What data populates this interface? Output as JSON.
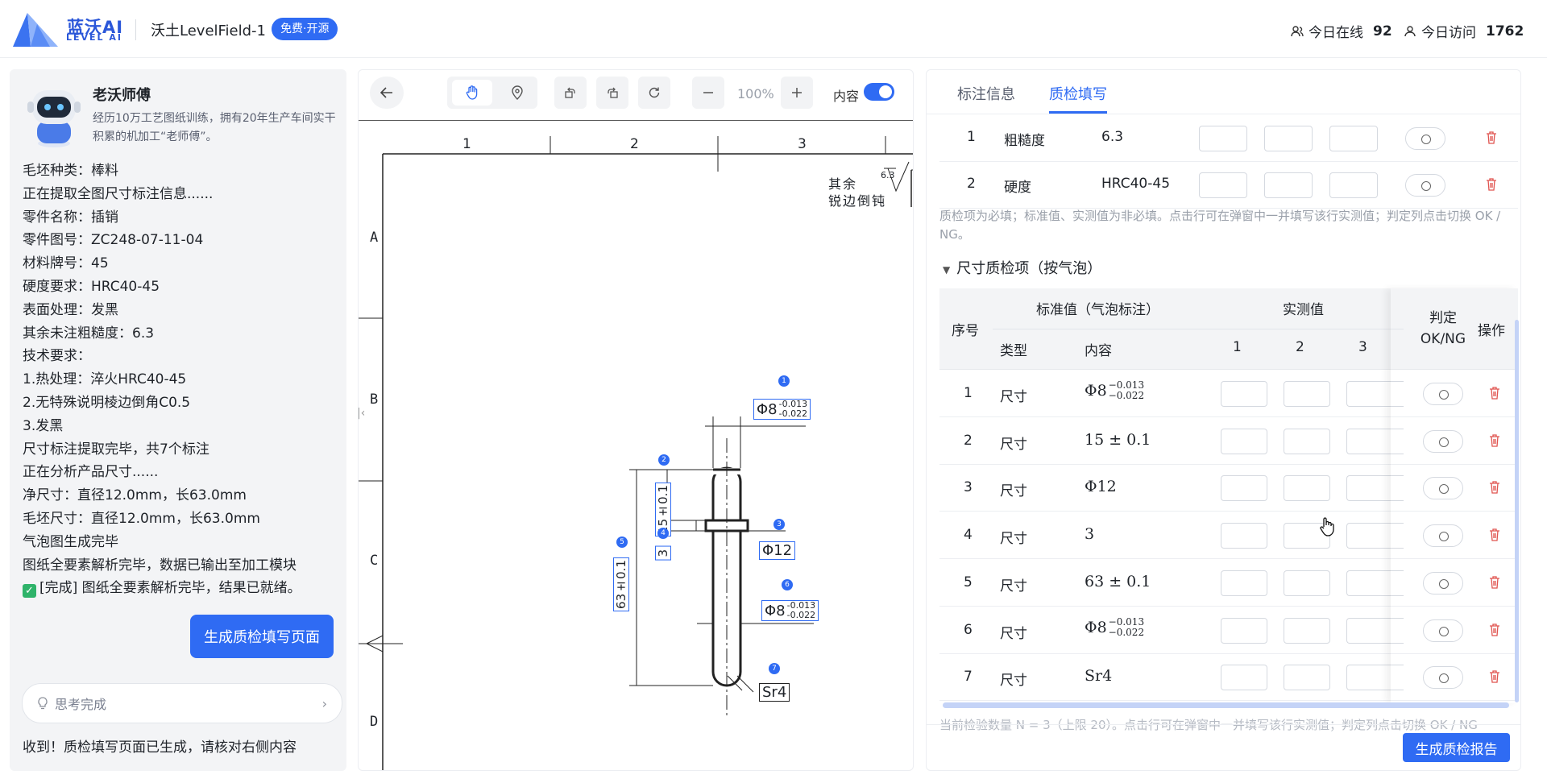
{
  "header": {
    "logo_cn": "蓝沃AI",
    "logo_en": "LEVEL AI",
    "app_title": "沃土LevelField-1",
    "badge": "免费·开源",
    "online_label": "今日在线",
    "online_count": "92",
    "visit_label": "今日访问",
    "visit_count": "1762"
  },
  "bot": {
    "name": "老沃师傅",
    "desc": "经历10万工艺图纸训练，拥有20年生产车间实干积累的机加工“老师傅”。"
  },
  "log": [
    "毛坯种类：棒料",
    "正在提取全图尺寸标注信息......",
    "零件名称：插销",
    "零件图号：ZC248-07-11-04",
    "材料牌号：45",
    "硬度要求：HRC40-45",
    "表面处理：发黑",
    "其余未注粗糙度：6.3",
    "技术要求：",
    "1.热处理：淬火HRC40-45",
    "2.无特殊说明棱边倒角C0.5",
    "3.发黑",
    "尺寸标注提取完毕，共7个标注",
    "正在分析产品尺寸......",
    "净尺寸：直径12.0mm，长63.0mm",
    "毛坯尺寸：直径12.0mm，长63.0mm",
    "气泡图生成完毕",
    "图纸全要素解析完毕，数据已输出至加工模块",
    "[完成] 图纸全要素解析完毕，结果已就绪。"
  ],
  "left_actions": {
    "generate_button": "生成质检填写页面",
    "thinking": "思考完成",
    "final_message": "收到！质检填写页面已生成，请核对右侧内容"
  },
  "viewer": {
    "zoom": "100%",
    "toggle_label": "内容",
    "border_numbers": [
      "1",
      "2",
      "3"
    ],
    "border_letters": [
      "A",
      "B",
      "C",
      "D"
    ],
    "note_line1": "其余",
    "note_line2": "锐边倒钝",
    "rough_value": "6.3",
    "dim_phi8_top": "Φ8",
    "dim_phi8_top_up": "-0.013",
    "dim_phi8_top_low": "-0.022",
    "dim_15": "15±0.1",
    "dim_phi12": "Φ12",
    "dim_3": "3",
    "dim_63": "63±0.1",
    "dim_phi8_bot": "Φ8",
    "dim_phi8_bot_up": "-0.013",
    "dim_phi8_bot_low": "-0.022",
    "dim_sr4": "Sr4",
    "bubbles": [
      "1",
      "2",
      "3",
      "4",
      "5",
      "6",
      "7"
    ]
  },
  "right": {
    "tabs": [
      "标注信息",
      "质检填写"
    ],
    "general_rows": [
      {
        "no": "1",
        "item": "粗糙度",
        "value": "6.3"
      },
      {
        "no": "2",
        "item": "硬度",
        "value": "HRC40-45"
      }
    ],
    "note": "质检项为必填；标准值、实测值为非必填。点击行可在弹窗中一并填写该行实测值；判定列点击切换 OK / NG。",
    "section_title": "尺寸质检项（按气泡）",
    "headers": {
      "no": "序号",
      "std": "标准值（气泡标注）",
      "type": "类型",
      "content": "内容",
      "measured": "实测值",
      "m1": "1",
      "m2": "2",
      "m3": "3",
      "judge_1": "判定",
      "judge_2": "OK/NG",
      "op": "操作"
    },
    "dim_rows": [
      {
        "no": "1",
        "type": "尺寸",
        "base": "Φ8",
        "upper": "−0.013",
        "lower": "−0.022"
      },
      {
        "no": "2",
        "type": "尺寸",
        "base": "15 ± 0.1",
        "upper": "",
        "lower": ""
      },
      {
        "no": "3",
        "type": "尺寸",
        "base": "Φ12",
        "upper": "",
        "lower": ""
      },
      {
        "no": "4",
        "type": "尺寸",
        "base": "3",
        "upper": "",
        "lower": ""
      },
      {
        "no": "5",
        "type": "尺寸",
        "base": "63 ± 0.1",
        "upper": "",
        "lower": ""
      },
      {
        "no": "6",
        "type": "尺寸",
        "base": "Φ8",
        "upper": "−0.013",
        "lower": "−0.022"
      },
      {
        "no": "7",
        "type": "尺寸",
        "base": "Sr4",
        "upper": "",
        "lower": ""
      }
    ],
    "footer_note": "当前检验数量 N = 3（上限 20）。点击行可在弹窗中一并填写该行实测值；判定列点击切换 OK / NG",
    "report_button": "生成质检报告"
  },
  "colors": {
    "accent": "#2f6bf3",
    "danger": "#e0534f",
    "success": "#2fb36a"
  }
}
